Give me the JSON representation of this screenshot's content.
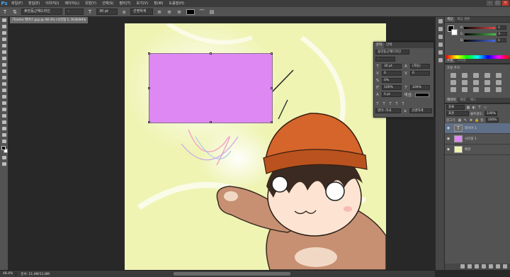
{
  "app": {
    "logo": "Ps"
  },
  "menu": [
    "파일(F)",
    "편집(E)",
    "이미지(I)",
    "레이어(L)",
    "유형(Y)",
    "선택(S)",
    "필터(T)",
    "보기(V)",
    "창(W)",
    "도움말(H)"
  ],
  "window_controls": [
    "–",
    "□",
    "×"
  ],
  "options": {
    "font_family": "휴먼둥근헤드라인",
    "font_style": "-",
    "font_size": "30 pt",
    "antialias": "선명하게",
    "text_color": "#000000"
  },
  "document": {
    "tab_title": "기(ashe 캔버스.jpg @ 48.4% (사각형 1, RGB/8#)",
    "close": "×",
    "zoom": "48.4%",
    "doc_size": "문서: 11.4M/11.8M"
  },
  "canvas": {
    "background": "#eff4b3",
    "shape_color": "#dd88f3"
  },
  "character_panel": {
    "tabs": [
      "문자",
      "단락"
    ],
    "font_family": "휴먼둥근헤드라인",
    "font_style": "-",
    "size": "30 pt",
    "leading": "(자동)",
    "kerning": "0",
    "tracking": "0",
    "vertical_scale": "100%",
    "horizontal_scale": "100%",
    "baseline": "0 pt",
    "color_label": "색상:",
    "language": "영어: 미국",
    "antialias": "선명하게"
  },
  "color_panel": {
    "tabs": [
      "색상",
      "색상 견본"
    ],
    "sliders": [
      {
        "label": "R",
        "value": "0",
        "color": "#e04a4a"
      },
      {
        "label": "G",
        "value": "0",
        "color": "#4ac04a"
      },
      {
        "label": "B",
        "value": "0",
        "color": "#4a6ae0"
      }
    ]
  },
  "adjustments_panel": {
    "tabs": [
      "조정",
      "스타일"
    ],
    "title": "조정 추가"
  },
  "layers_panel": {
    "tabs": [
      "레이어",
      "채널",
      "패스"
    ],
    "filter_label": "종류",
    "blend_mode": "표준",
    "opacity_label": "불투명도:",
    "opacity": "100%",
    "lock_label": "잠그기:",
    "fill_label": "칠:",
    "fill": "100%",
    "layers": [
      {
        "name": "레이어 1",
        "type": "text",
        "glyph": "T",
        "selected": true
      },
      {
        "name": "사각형 1",
        "type": "shape",
        "glyph": "",
        "selected": false
      },
      {
        "name": "배경",
        "type": "background",
        "glyph": "",
        "selected": false
      }
    ]
  }
}
